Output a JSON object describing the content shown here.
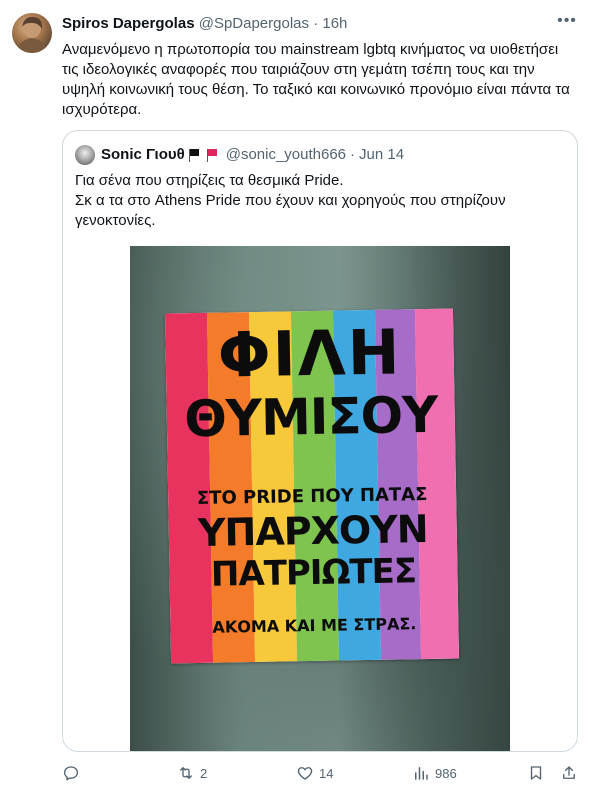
{
  "author": {
    "name": "Spiros Dapergolas",
    "handle": "@SpDapergolas",
    "separator": "·",
    "time": "16h"
  },
  "tweet": {
    "text": "Αναμενόμενο η πρωτοπορία του mainstream lgbtq κινήματος να υιοθετήσει τις ιδεολογικές αναφορές που ταιριάζουν στη γεμάτη τσέπη τους και την υψηλή κοινωνική τους θέση. Το ταξικό και κοινωνικό προνόμιο είναι πάντα τα ισχυρότερα."
  },
  "quote": {
    "name": "Sonic Γιουθ",
    "handle": "@sonic_youth666",
    "separator": "·",
    "date": "Jun 14",
    "line1": "Για σένα που στηρίζεις τα θεσμικά Pride.",
    "line2": "Σκ α τα στο Athens Pride που έχουν και χορηγούς που στηρίζουν γενοκτονίες.",
    "poster": {
      "line1": "ΦΙΛΗ",
      "line2": "ΘΥΜΙΣΟΥ",
      "line3": "ΣΤΟ PRIDE ΠΟΥ ΠΑΤΑΣ",
      "line4": "ΥΠΑΡΧΟΥΝ",
      "line5": "ΠΑΤΡΙΩΤΕΣ",
      "line6": "ΑΚΟΜΑ ΚΑΙ ΜΕ ΣΤΡΑΣ."
    }
  },
  "actions": {
    "reply_icon": "reply-icon",
    "retweet_count": "2",
    "like_count": "14",
    "views_count": "986",
    "bookmark_icon": "bookmark-icon",
    "share_icon": "share-icon"
  },
  "colors": {
    "muted": "#536471",
    "border": "#cfd9de",
    "flag_red": "#e0245e",
    "flag_black": "#111111",
    "stripes": [
      "#e8335f",
      "#f47b2a",
      "#f6c83a",
      "#7fc44e",
      "#3fa8e0",
      "#a76cc8",
      "#f06fb0"
    ]
  }
}
